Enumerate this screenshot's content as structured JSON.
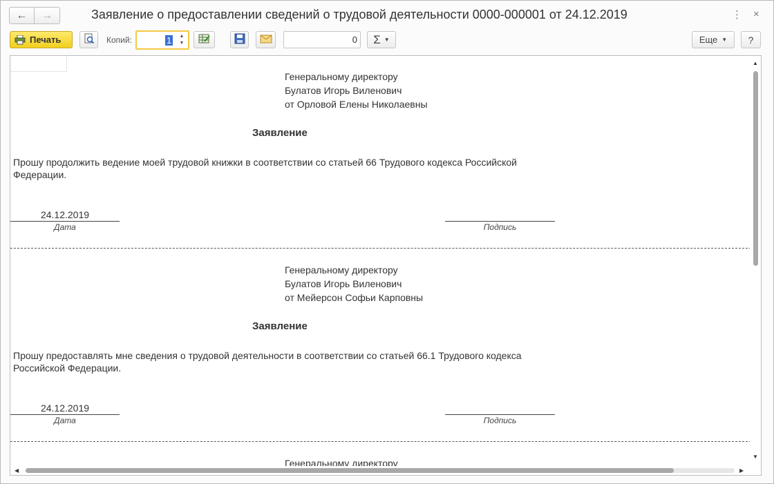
{
  "window": {
    "title": "Заявление о предоставлении сведений о трудовой деятельности 0000-000001 от 24.12.2019",
    "back_glyph": "🡐",
    "forward_glyph": "🡒",
    "more_glyph": "⋮",
    "close_glyph": "×"
  },
  "toolbar": {
    "print_label": "Печать",
    "copies_label": "Копий:",
    "copies_value": "1",
    "sum_value": "0",
    "sum_symbol": "Σ",
    "more_label": "Еще",
    "help_label": "?"
  },
  "colors": {
    "print_button": "#f2cf1f",
    "focus_border": "#f4c842",
    "selection": "#3a6fd1"
  },
  "icons": {
    "print": "printer-icon",
    "preview": "page-preview-icon",
    "edit": "edit-table-icon",
    "save": "save-disk-icon",
    "mail": "envelope-icon"
  },
  "document": {
    "sections": [
      {
        "to_line1": "Генеральному директору",
        "to_line2": "Булатов Игорь Виленович",
        "from_line": "от Орловой Елены Николаевны",
        "heading": "Заявление",
        "body": "Прошу продолжить ведение моей трудовой книжки в соответствии со статьей 66 Трудового кодекса Российской Федерации.",
        "date": "24.12.2019",
        "date_caption": "Дата",
        "signature_caption": "Подпись"
      },
      {
        "to_line1": "Генеральному директору",
        "to_line2": "Булатов Игорь Виленович",
        "from_line": "от Мейерсон Софьи Карповны",
        "heading": "Заявление",
        "body": "Прошу предоставлять мне сведения о трудовой деятельности в соответствии со статьей 66.1 Трудового кодекса Российской Федерации.",
        "date": "24.12.2019",
        "date_caption": "Дата",
        "signature_caption": "Подпись"
      },
      {
        "to_line1": "Генеральному директору"
      }
    ]
  }
}
